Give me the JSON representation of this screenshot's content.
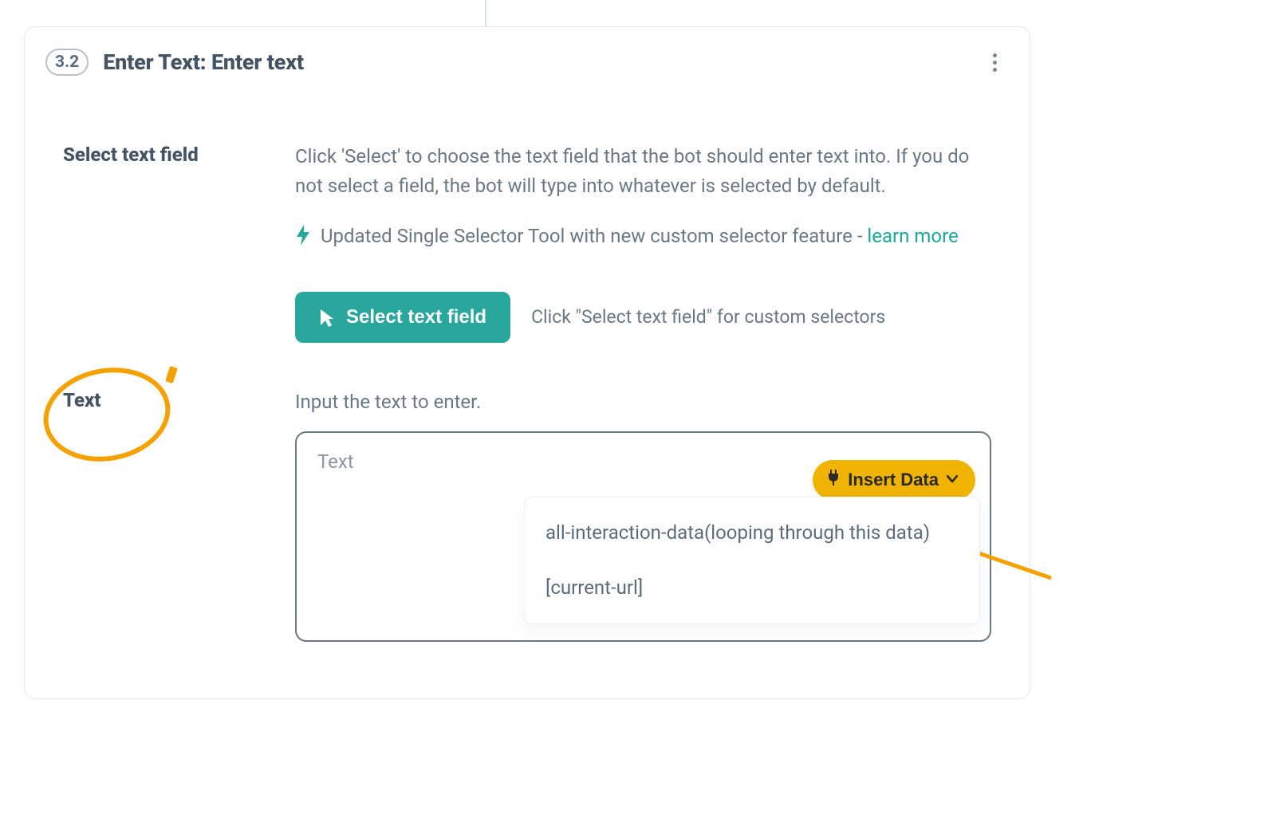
{
  "step": {
    "number": "3.2",
    "title": "Enter Text: Enter text"
  },
  "sections": {
    "select_field": {
      "label": "Select text field",
      "description": "Click 'Select' to choose the text field that the bot should enter text into. If you do not select a field, the bot will type into whatever is selected by default.",
      "update_text": "Updated Single Selector Tool with new custom selector feature -",
      "learn_more": "learn more",
      "button_label": "Select text field",
      "hint": "Click \"Select text field\" for custom selectors"
    },
    "text": {
      "label": "Text",
      "description": "Input the text to enter.",
      "placeholder": "Text",
      "insert_button": "Insert Data",
      "dropdown_items": [
        "all-interaction-data(looping through this data)",
        "[current-url]"
      ]
    }
  },
  "colors": {
    "accent_teal": "#2aa79c",
    "accent_yellow": "#efb300",
    "anno_orange": "#f5a200"
  }
}
